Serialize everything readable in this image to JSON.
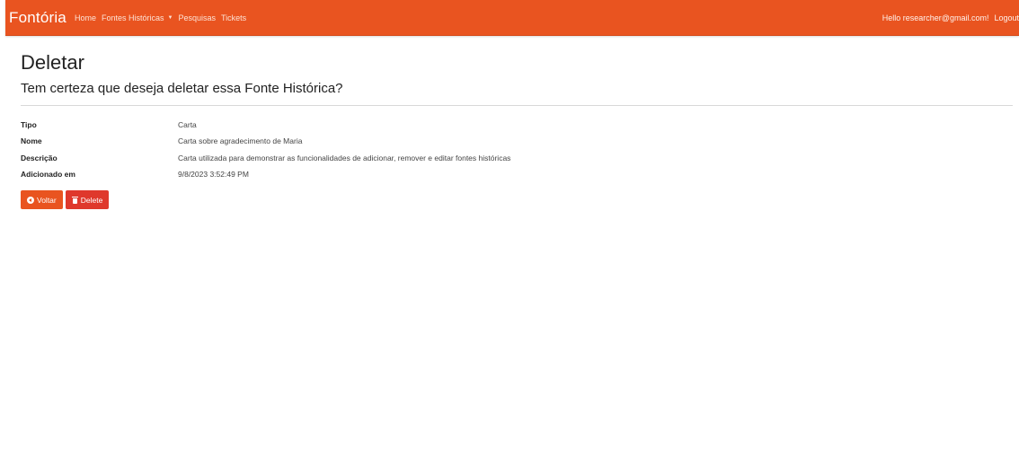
{
  "navbar": {
    "brand": "Fontória",
    "links": {
      "home": "Home",
      "fontes": "Fontes Históricas",
      "pesquisas": "Pesquisas",
      "tickets": "Tickets"
    },
    "greeting": "Hello researcher@gmail.com!",
    "logout": "Logout",
    "color": "#e95420"
  },
  "page": {
    "title": "Deletar",
    "subtitle": "Tem certeza que deseja deletar essa Fonte Histórica?"
  },
  "details": {
    "tipo": {
      "label": "Tipo",
      "value": "Carta"
    },
    "nome": {
      "label": "Nome",
      "value": "Carta sobre agradecimento de Maria"
    },
    "descricao": {
      "label": "Descrição",
      "value": "Carta utilizada para demonstrar as funcionalidades de adicionar, remover e editar fontes históricas"
    },
    "adicionado": {
      "label": "Adicionado em",
      "value": "9/8/2023 3:52:49 PM"
    }
  },
  "actions": {
    "back": {
      "label": "Voltar",
      "icon": "arrow-circle-left-icon",
      "color": "#e95420"
    },
    "delete": {
      "label": "Delete",
      "icon": "trash-icon",
      "color": "#df382c"
    }
  }
}
